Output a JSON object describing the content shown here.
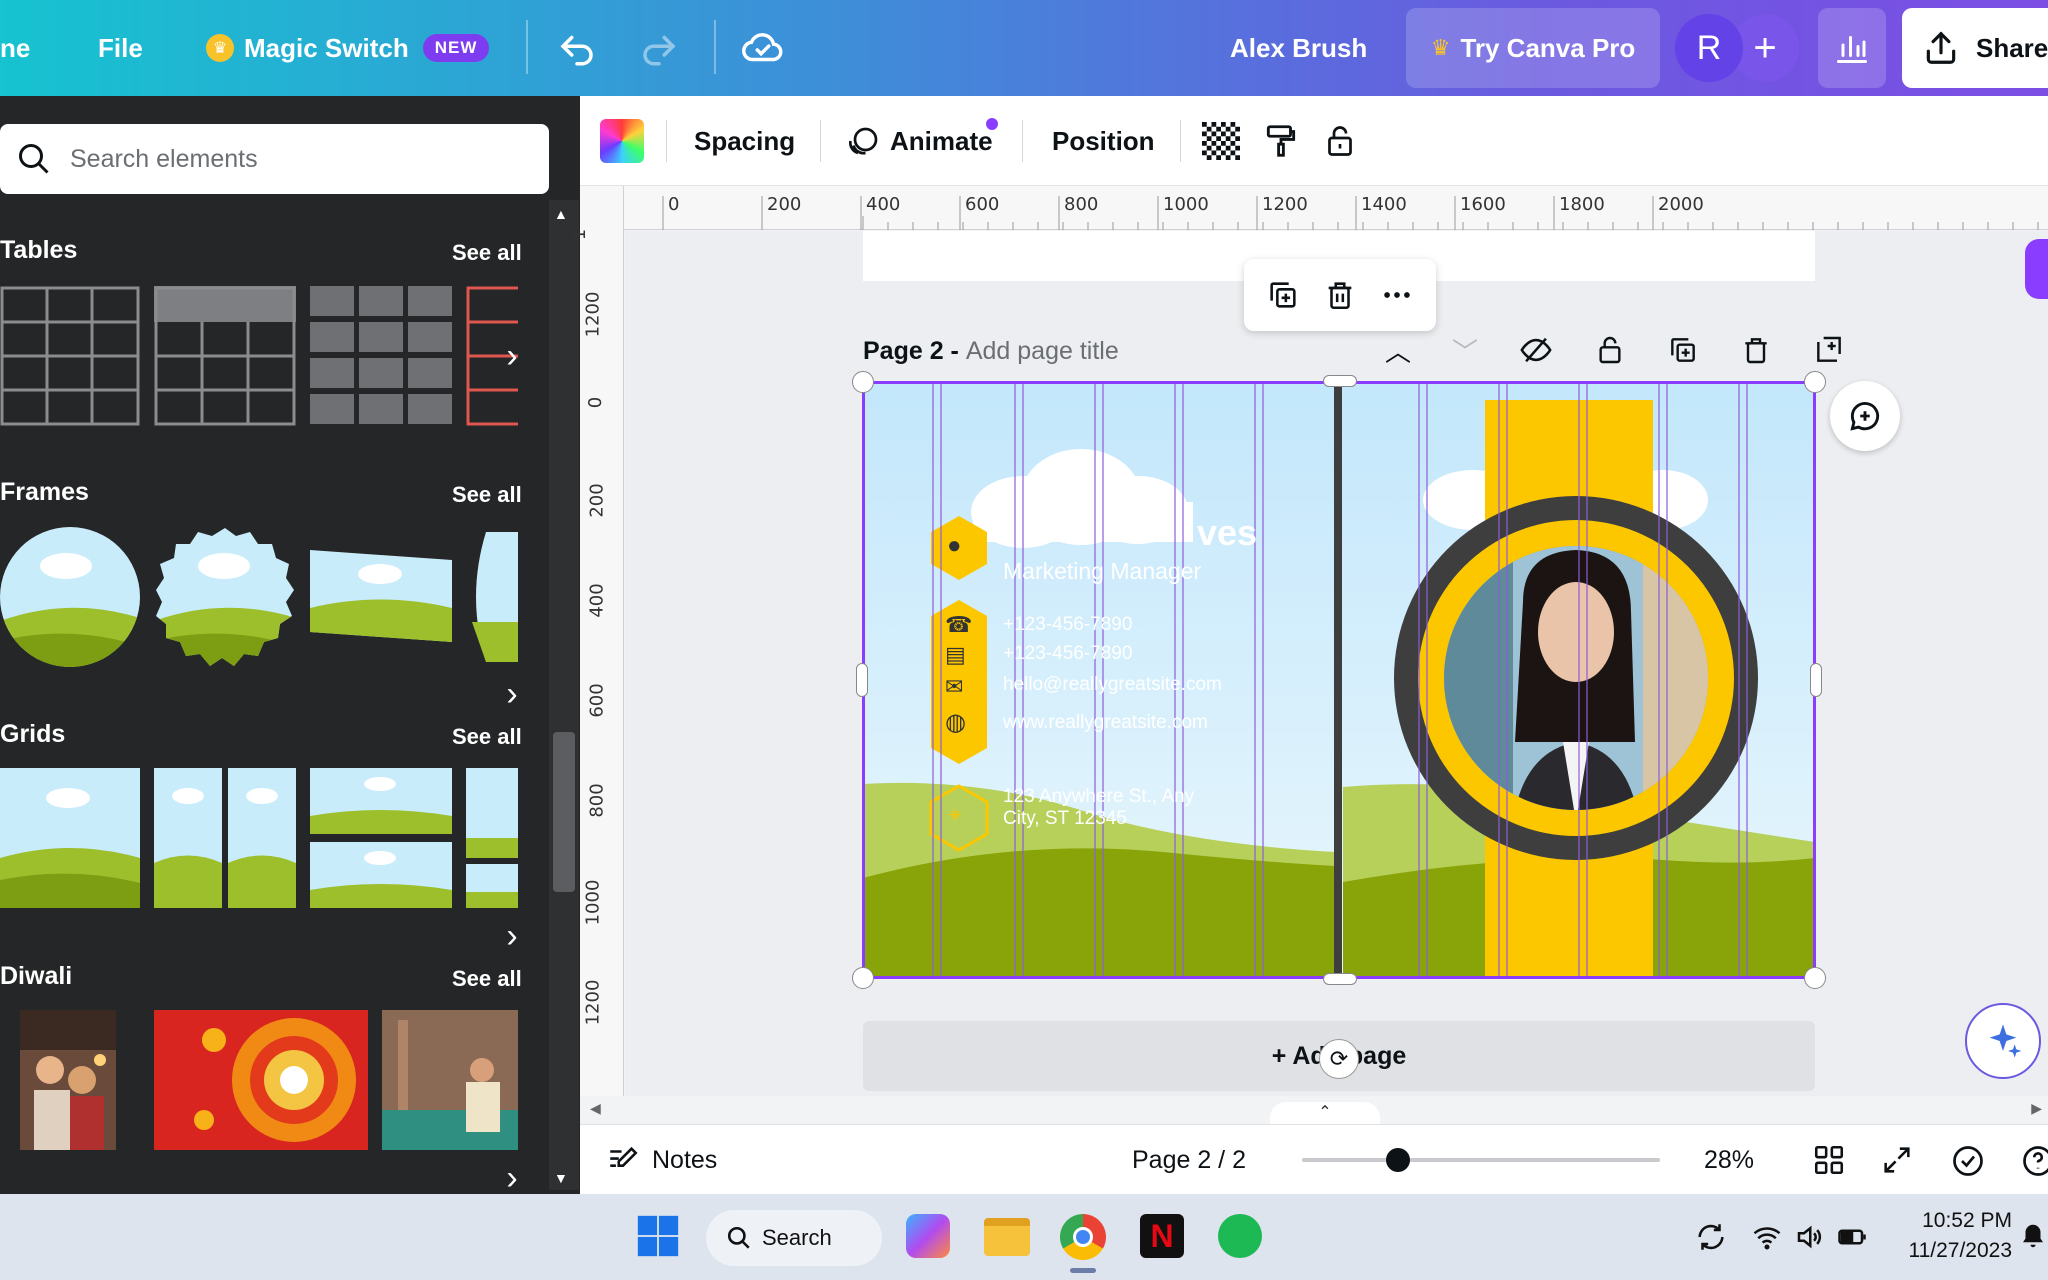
{
  "topbar": {
    "home_partial": "ne",
    "file": "File",
    "magic_switch": "Magic Switch",
    "new_badge": "NEW",
    "font_name": "Alex Brush",
    "try_pro": "Try Canva Pro",
    "avatar_letter": "R",
    "share": "Share"
  },
  "sidebar": {
    "search_placeholder": "Search elements",
    "sections": [
      {
        "title": "Tables",
        "see_all": "See all"
      },
      {
        "title": "Frames",
        "see_all": "See all"
      },
      {
        "title": "Grids",
        "see_all": "See all"
      },
      {
        "title": "Diwali",
        "see_all": "See all"
      }
    ]
  },
  "toolbar": {
    "spacing": "Spacing",
    "animate": "Animate",
    "position": "Position"
  },
  "ruler": {
    "top": [
      "0",
      "200",
      "400",
      "600",
      "800",
      "1000",
      "1200",
      "1400",
      "1600",
      "1800",
      "2000"
    ],
    "left": [
      "1",
      "1200",
      "0",
      "200",
      "400",
      "600",
      "800",
      "1000",
      "1200"
    ]
  },
  "page": {
    "label": "Page 2 - ",
    "title_placeholder": "Add page title",
    "add_page": "+ Add page"
  },
  "card": {
    "name_partial": "ves",
    "job_title": "Marketing Manager",
    "phone1": "+123-456-7890",
    "phone2": "+123-456-7890",
    "email": "hello@reallygreatsite.com",
    "website": "www.reallygreatsite.com",
    "address1": "123 Anywhere St., Any",
    "address2": "City, ST 12345"
  },
  "bottombar": {
    "notes": "Notes",
    "page_indicator": "Page 2 / 2",
    "zoom": "28%",
    "zoom_level": 0.28
  },
  "taskbar": {
    "search": "Search",
    "time": "10:52 PM",
    "date": "11/27/2023"
  },
  "colors": {
    "accent": "#8b3dff",
    "card_yellow": "#fdc700",
    "grass": "#8aa60a",
    "sky": "#cfeefb"
  }
}
